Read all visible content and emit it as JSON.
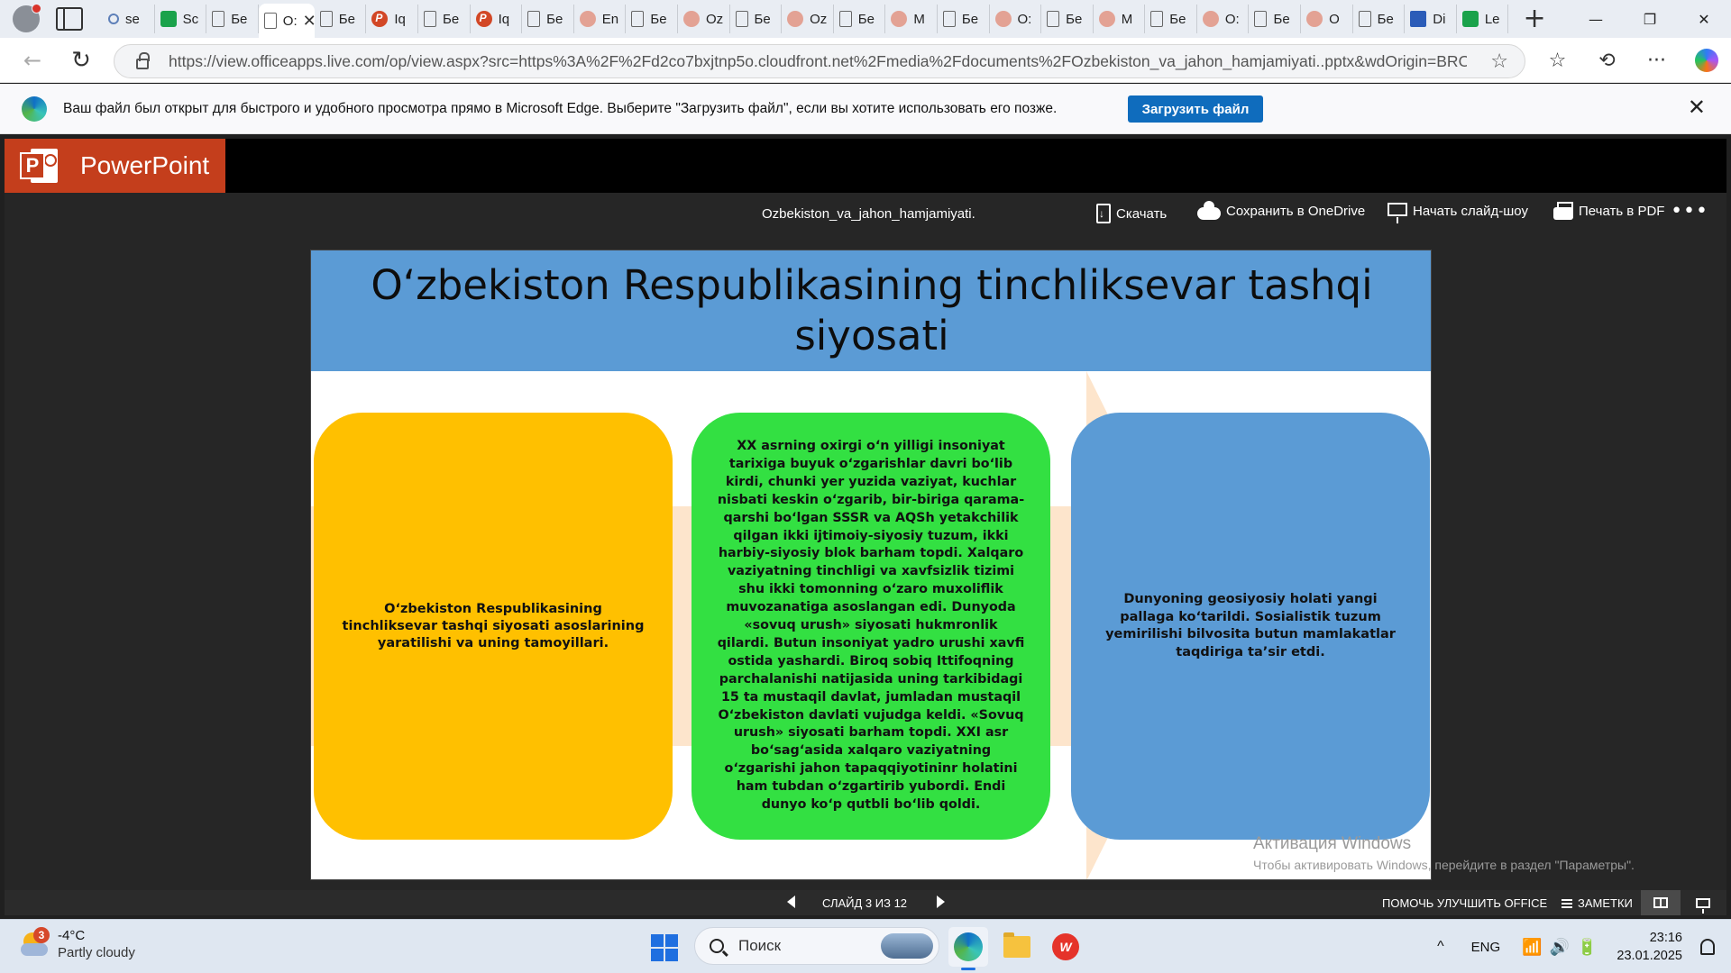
{
  "browser": {
    "tabs": [
      {
        "icon": "search-icon",
        "label": "se"
      },
      {
        "icon": "app-icon",
        "label": "Sc"
      },
      {
        "icon": "document-icon",
        "label": "Бе"
      },
      {
        "icon": "document-icon",
        "label": "O:",
        "active": true
      },
      {
        "icon": "document-icon",
        "label": "Бе"
      },
      {
        "icon": "powerpoint-icon",
        "label": "Iq"
      },
      {
        "icon": "document-icon",
        "label": "Бе"
      },
      {
        "icon": "powerpoint-icon",
        "label": "Iq"
      },
      {
        "icon": "document-icon",
        "label": "Бе"
      },
      {
        "icon": "powerpoint-faded-icon",
        "label": "En"
      },
      {
        "icon": "document-icon",
        "label": "Бе"
      },
      {
        "icon": "powerpoint-faded-icon",
        "label": "Oz"
      },
      {
        "icon": "document-icon",
        "label": "Бе"
      },
      {
        "icon": "powerpoint-faded-icon",
        "label": "Oz"
      },
      {
        "icon": "document-icon",
        "label": "Бе"
      },
      {
        "icon": "powerpoint-faded-icon",
        "label": "M"
      },
      {
        "icon": "document-icon",
        "label": "Бе"
      },
      {
        "icon": "powerpoint-faded-icon",
        "label": "O:"
      },
      {
        "icon": "document-icon",
        "label": "Бе"
      },
      {
        "icon": "powerpoint-faded-icon",
        "label": "M"
      },
      {
        "icon": "document-icon",
        "label": "Бе"
      },
      {
        "icon": "powerpoint-faded-icon",
        "label": "O:"
      },
      {
        "icon": "document-icon",
        "label": "Бе"
      },
      {
        "icon": "powerpoint-faded-icon",
        "label": "O"
      },
      {
        "icon": "document-icon",
        "label": "Бе"
      },
      {
        "icon": "word-icon",
        "label": "Di"
      },
      {
        "icon": "app-icon",
        "label": "Le"
      }
    ],
    "active_tab_close": "✕",
    "new_tab": "+",
    "window_buttons": {
      "minimize": "—",
      "maximize": "❐",
      "close": "✕"
    },
    "url": "https://view.officeapps.live.com/op/view.aspx?src=https%3A%2F%2Fd2co7bxjtnp5o.cloudfront.net%2Fmedia%2Fdocuments%2FOzbekiston_va_jahon_hamjamiyati..pptx&wdOrigin=BRO...",
    "nav": {
      "back": "←",
      "reload": "↻",
      "favorite": "☆"
    },
    "toolbar_right": {
      "favorites": "☆",
      "history": "⟲",
      "more": "···"
    }
  },
  "infobar": {
    "message": "Ваш файл был открыт для быстрого и удобного просмотра прямо в Microsoft Edge. Выберите \"Загрузить файл\", если вы хотите использовать его позже.",
    "button": "Загрузить файл",
    "close": "✕"
  },
  "ppt": {
    "app_name": "PowerPoint",
    "logo_letter": "P",
    "filename": "Ozbekiston_va_jahon_hamjamiyati.",
    "commands": {
      "download": "Скачать",
      "save_onedrive": "Сохранить в OneDrive",
      "slideshow": "Начать слайд-шоу",
      "print_pdf": "Печать в PDF",
      "more": "•••"
    }
  },
  "slide": {
    "title": "O‘zbekiston Respublikasining tinchliksevar tashqi siyosati",
    "box_left": "O‘zbekiston Respublikasining tinchliksevar tashqi siyosati  asoslarining yaratilishi va uning tamoyillari.",
    "box_center": "XX asrning oxirgi o‘n yilligi insoniyat tarixiga buyuk o‘zgarishlar davri bo‘lib kirdi, chunki yer yuzida vaziyat, kuchlar nisbati keskin o‘zgarib, bir-biriga qarama-qarshi bo‘lgan SSSR va AQSh yetakchilik qilgan ikki ijtimoiy-siyosiy tuzum, ikki harbiy-siyosiy blok barham topdi. Xalqaro vaziyatning tinchligi va xavfsizlik tizimi shu ikki tomonning o‘zaro muxoliflik muvozanatiga asoslangan edi. Dunyoda «sovuq urush» siyosati hukmronlik qilardi. Butun insoniyat yadro urushi xavfi ostida yashardi. Biroq sobiq Ittifoqning parchalanishi natijasida uning tarkibidagi 15 ta mustaqil davlat, jumladan mustaqil O‘zbekiston davlati vujudga keldi. «Sovuq  urush» siyosati barham topdi. XXI asr bo‘sag‘asida xalqaro vaziyatning o‘zgarishi jahon tapaqqiyotininr holatini ham tubdan o‘zgartirib yubordi. Endi dunyo ko‘p qutbli bo‘lib qoldi.",
    "box_right": "Dunyoning geosiyosiy holati yangi pallaga ko‘tarildi.   Sosialistik tuzum yemirilishi bilvosita butun mamlakatlar taqdiriga ta’sir etdi.",
    "colors": {
      "header": "#5b9bd5",
      "left": "#ffc000",
      "center": "#33e042",
      "right": "#5b9bd5",
      "arrow": "#fde5cc"
    }
  },
  "watermark": {
    "line1": "Активация Windows",
    "line2": "Чтобы активировать Windows, перейдите в раздел \"Параметры\"."
  },
  "status": {
    "slide_counter": "СЛАЙД 3 ИЗ 12",
    "help": "ПОМОЧЬ УЛУЧШИТЬ OFFICE",
    "notes": "ЗАМЕТКИ"
  },
  "taskbar": {
    "weather_badge": "3",
    "temperature": "-4°C",
    "condition": "Partly cloudy",
    "search_placeholder": "Поиск",
    "wps_label": "W",
    "tray_chevron": "^",
    "language": "ENG",
    "system_icons": "📶🔊🔋",
    "time": "23:16",
    "date": "23.01.2025"
  }
}
